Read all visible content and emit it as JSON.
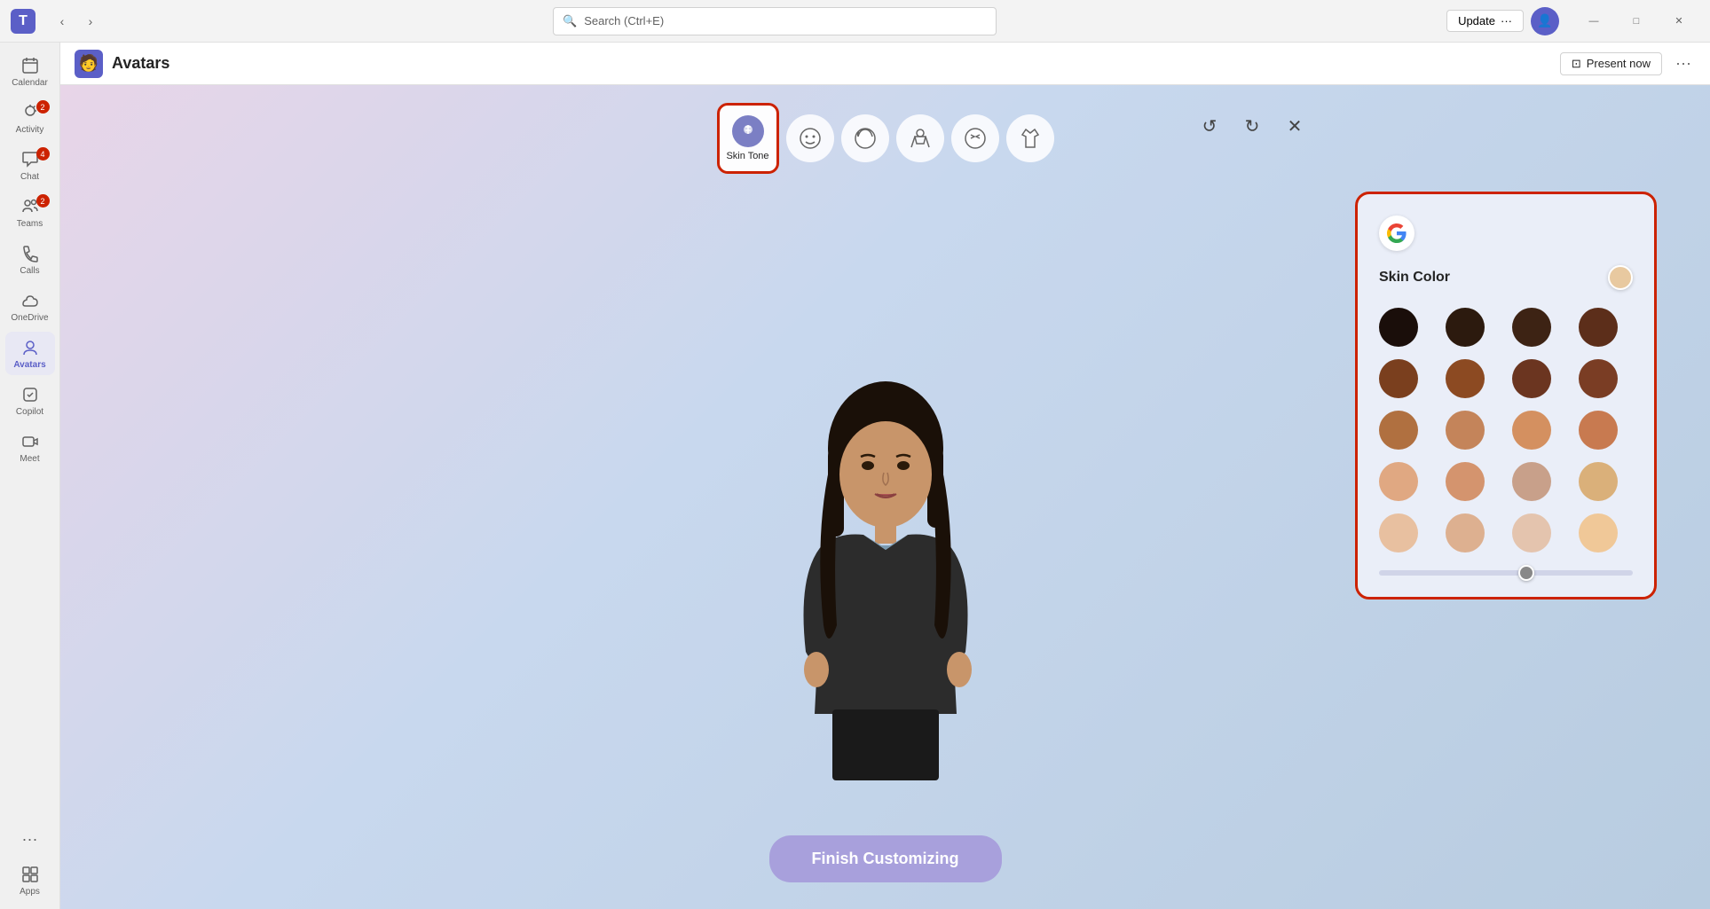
{
  "titlebar": {
    "app_icon": "T",
    "nav_back": "‹",
    "nav_fwd": "›",
    "search_placeholder": "Search (Ctrl+E)",
    "update_label": "Update",
    "update_dots": "···",
    "minimize": "—",
    "maximize": "□",
    "close": "✕"
  },
  "sidebar": {
    "items": [
      {
        "id": "calendar",
        "label": "Calendar",
        "icon": "📅",
        "badge": null
      },
      {
        "id": "activity",
        "label": "Activity",
        "icon": "🔔",
        "badge": "2"
      },
      {
        "id": "chat",
        "label": "Chat",
        "icon": "💬",
        "badge": "4"
      },
      {
        "id": "teams",
        "label": "Teams",
        "icon": "👥",
        "badge": "2"
      },
      {
        "id": "calls",
        "label": "Calls",
        "icon": "📞",
        "badge": null
      },
      {
        "id": "onedrive",
        "label": "OneDrive",
        "icon": "☁",
        "badge": null
      },
      {
        "id": "avatars",
        "label": "Avatars",
        "icon": "🧑",
        "badge": null,
        "active": true
      },
      {
        "id": "copilot",
        "label": "Copilot",
        "icon": "⬜",
        "badge": null
      },
      {
        "id": "meet",
        "label": "Meet",
        "icon": "🎥",
        "badge": null
      },
      {
        "id": "apps",
        "label": "Apps",
        "icon": "⊞",
        "badge": null
      }
    ],
    "dots_label": "···"
  },
  "page_header": {
    "icon": "🧑",
    "title": "Avatars",
    "present_now": "Present now",
    "more_icon": "···"
  },
  "toolbar": {
    "items": [
      {
        "id": "skin-tone",
        "label": "Skin Tone",
        "active": true
      },
      {
        "id": "face",
        "label": "",
        "icon": "😊"
      },
      {
        "id": "hair",
        "label": "",
        "icon": "💇"
      },
      {
        "id": "body",
        "label": "",
        "icon": "🧍"
      },
      {
        "id": "features",
        "label": "",
        "icon": "✋"
      },
      {
        "id": "clothing",
        "label": "",
        "icon": "👕"
      }
    ],
    "undo": "↺",
    "redo": "↻",
    "close": "✕"
  },
  "finish_button": {
    "label": "Finish Customizing"
  },
  "skin_panel": {
    "title": "Skin Color",
    "colors_row1": [
      "#1a0e0a",
      "#2c1a0e",
      "#3d2314",
      "#5c2e1a"
    ],
    "colors_row2": [
      "#7a3f1e",
      "#8c4a22",
      "#6b3520",
      "#7a3d24"
    ],
    "colors_row3": [
      "#b07040",
      "#c4845a",
      "#d49060",
      "#c87a50"
    ],
    "colors_row4": [
      "#e0a882",
      "#d4946e",
      "#c8a08a",
      "#dab07a"
    ],
    "colors_row5": [
      "#e8c0a0",
      "#ddb090",
      "#e4c4ae",
      "#f0c898"
    ],
    "selected_color": "#e8c9a0"
  }
}
